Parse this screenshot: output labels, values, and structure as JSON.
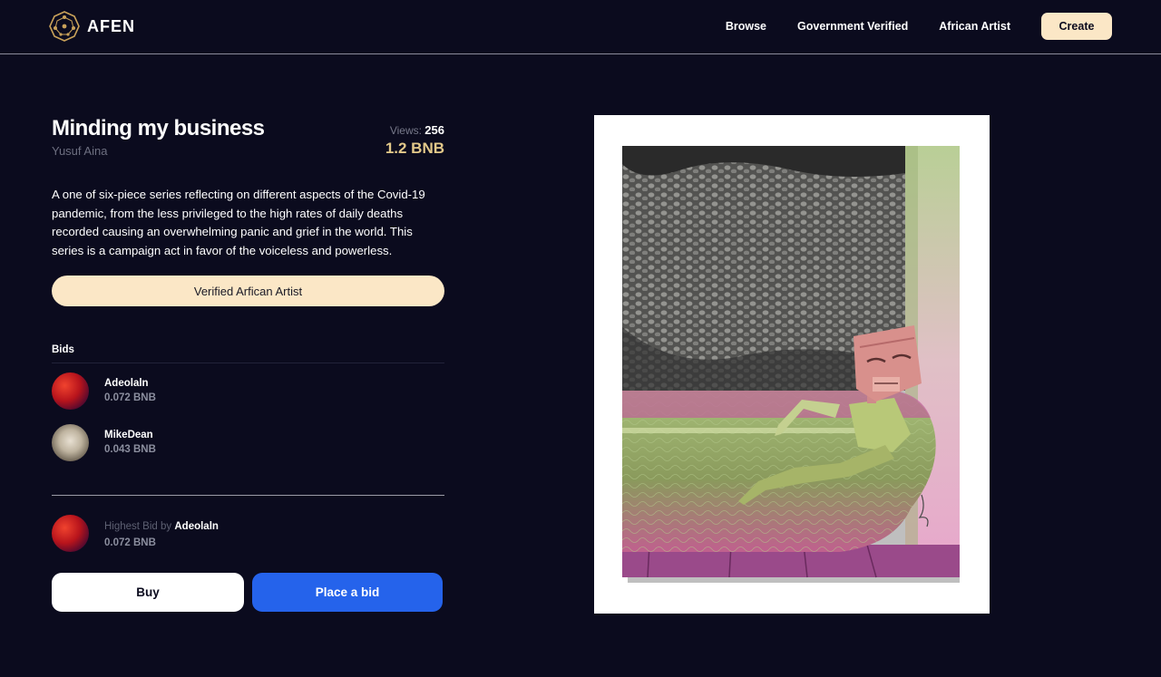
{
  "header": {
    "logo_text": "AFEN",
    "nav": [
      "Browse",
      "Government Verified",
      "African Artist"
    ],
    "create_label": "Create"
  },
  "artwork": {
    "title": "Minding my business",
    "artist": "Yusuf Aina",
    "views_label": "Views:",
    "views_value": "256",
    "price": "1.2 BNB",
    "description": "A one of six-piece series reflecting on different aspects of the Covid-19 pandemic, from the less privileged to the high rates of daily deaths recorded causing an overwhelming panic and grief in the world. This series is a campaign act in favor of the voiceless and powerless.",
    "badge": "Verified Arfican Artist"
  },
  "bids": {
    "heading": "Bids",
    "items": [
      {
        "name": "Adeolaln",
        "amount": "0.072 BNB"
      },
      {
        "name": "MikeDean",
        "amount": "0.043 BNB"
      }
    ]
  },
  "highest_bid": {
    "label": "Highest Bid by ",
    "name": "Adeolaln",
    "amount": "0.072 BNB"
  },
  "actions": {
    "buy_label": "Buy",
    "bid_label": "Place a bid"
  },
  "colors": {
    "background": "#0b0b1e",
    "accent_cream": "#fbe7c6",
    "price_gold": "#e3c98a",
    "primary_blue": "#2563eb"
  }
}
